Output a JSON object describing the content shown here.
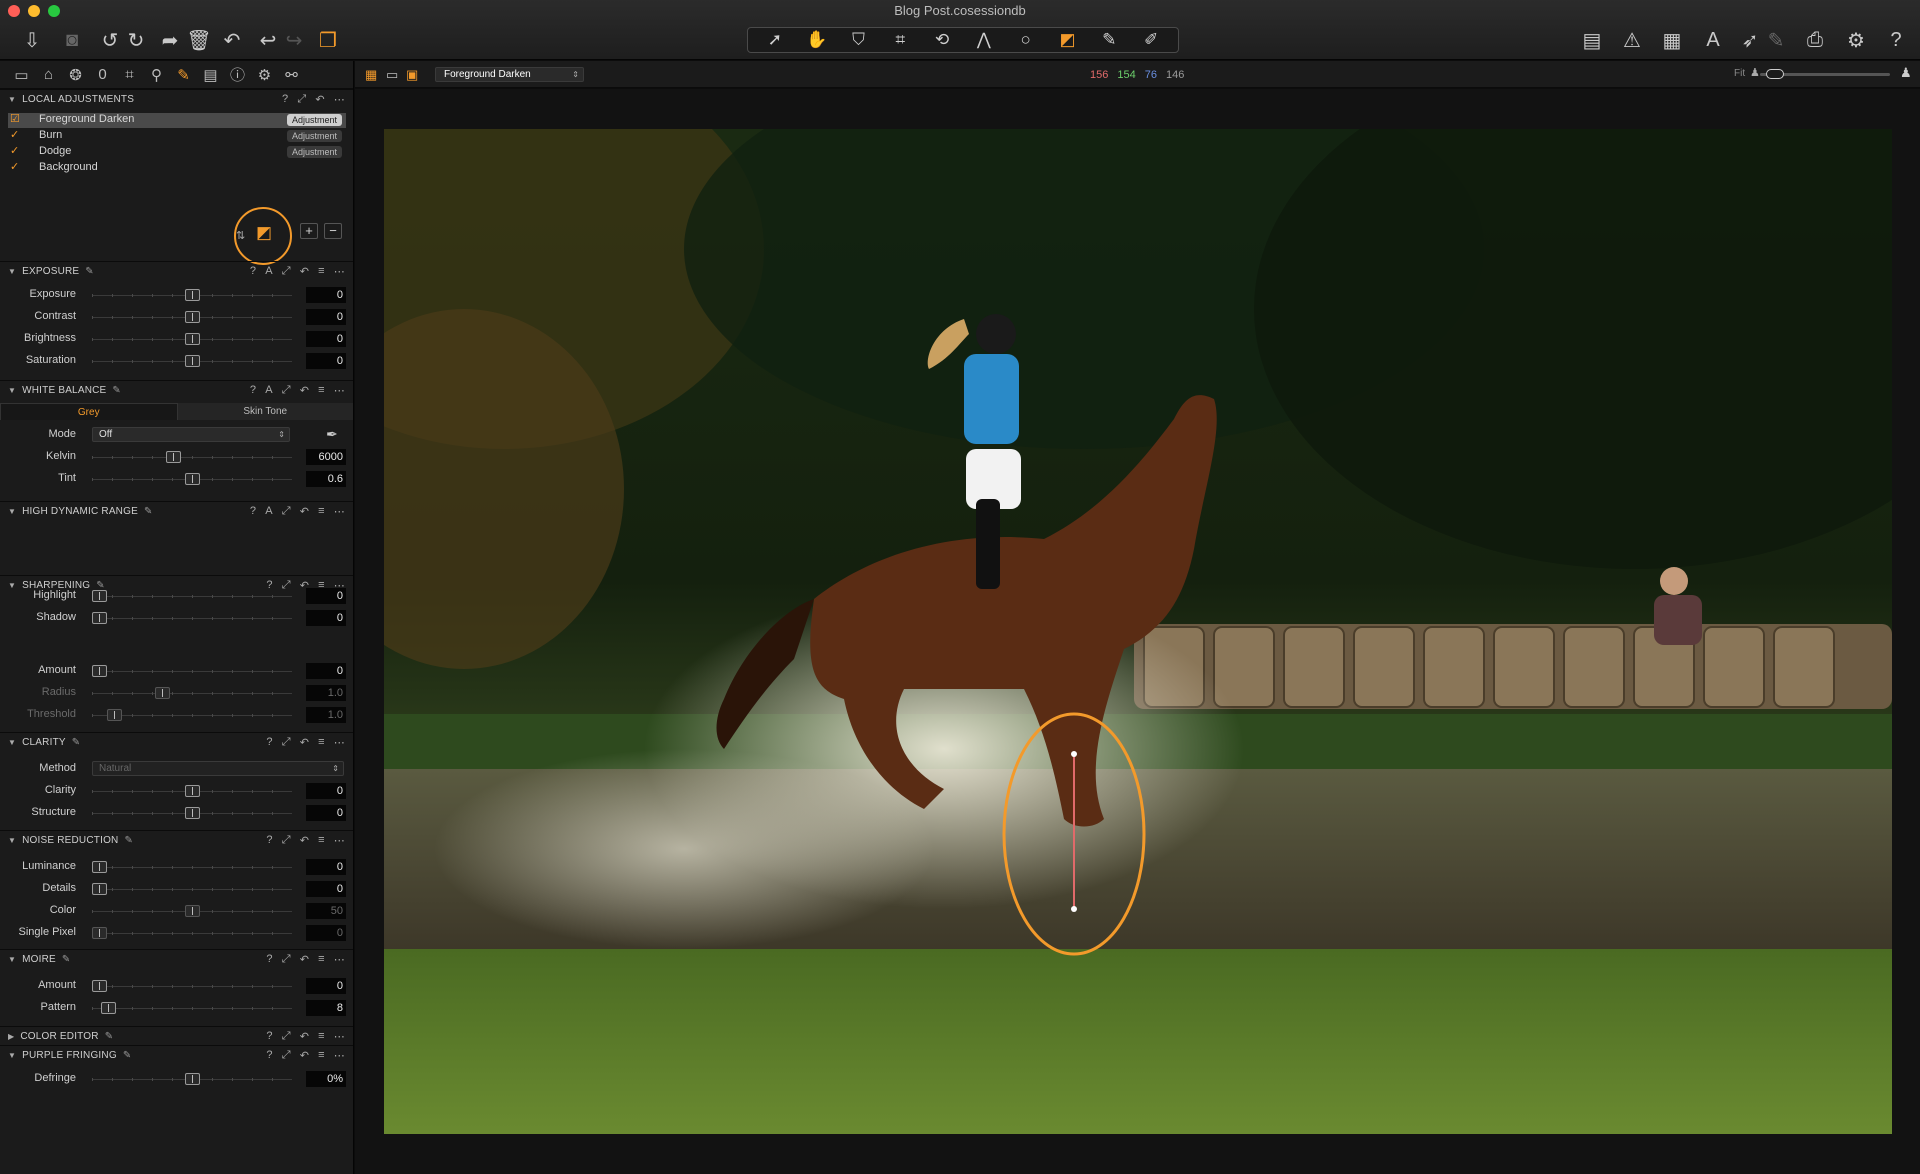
{
  "window": {
    "title": "Blog Post.cosessiondb",
    "traffic_colors": [
      "#ff5f57",
      "#febc2e",
      "#28c840"
    ]
  },
  "toolbar": {
    "left_icons": [
      "import-icon",
      "camera-icon",
      "rotate-left-icon",
      "rotate-right-icon",
      "export-icon",
      "trash-icon",
      "undo-icon",
      "redo-icon",
      "variants-icon"
    ],
    "cursor_tools": [
      "select-icon",
      "pan-icon",
      "loupe-icon",
      "crop-icon",
      "straighten-icon",
      "keystone-icon",
      "spot-icon",
      "draw-mask-icon",
      "erase-mask-icon",
      "copy-icon"
    ],
    "right_icons": [
      "layout-icon",
      "warning-icon",
      "grid-icon",
      "text-icon",
      "color-picker-icon",
      "apply-icon",
      "print-icon",
      "settings-icon",
      "help-icon"
    ]
  },
  "panel_tabs": [
    "folder-icon",
    "capture-icon",
    "color-icon",
    "lens-icon",
    "crop-tab-icon",
    "focus-icon",
    "brush-icon",
    "metadata-icon",
    "info-icon",
    "adjust-icon",
    "output-icon"
  ],
  "local_adjustments": {
    "title": "LOCAL ADJUSTMENTS",
    "layers": [
      {
        "name": "Foreground Darken",
        "badge": "Adjustment",
        "selected": true
      },
      {
        "name": "Burn",
        "badge": "Adjustment",
        "selected": false
      },
      {
        "name": "Dodge",
        "badge": "Adjustment",
        "selected": false
      },
      {
        "name": "Background",
        "badge": "",
        "selected": false
      }
    ]
  },
  "exposure": {
    "title": "EXPOSURE",
    "rows": [
      {
        "label": "Exposure",
        "value": "0",
        "level": 0.5
      },
      {
        "label": "Contrast",
        "value": "0",
        "level": 0.5
      },
      {
        "label": "Brightness",
        "value": "0",
        "level": 0.5
      },
      {
        "label": "Saturation",
        "value": "0",
        "level": 0.5
      }
    ]
  },
  "white_balance": {
    "title": "WHITE BALANCE",
    "tabs": [
      "Grey",
      "Skin Tone"
    ],
    "mode_label": "Mode",
    "mode_value": "Off",
    "rows": [
      {
        "label": "Kelvin",
        "value": "6000",
        "level": 0.4
      },
      {
        "label": "Tint",
        "value": "0.6",
        "level": 0.5
      }
    ]
  },
  "hdr": {
    "title": "HIGH DYNAMIC RANGE",
    "rows": [
      {
        "label": "Highlight",
        "value": "0",
        "level": 0.0
      },
      {
        "label": "Shadow",
        "value": "0",
        "level": 0.0
      }
    ]
  },
  "sharpening": {
    "title": "SHARPENING",
    "rows": [
      {
        "label": "Amount",
        "value": "0",
        "level": 0.0,
        "dim": false
      },
      {
        "label": "Radius",
        "value": "1.0",
        "level": 0.34,
        "dim": true
      },
      {
        "label": "Threshold",
        "value": "1.0",
        "level": 0.08,
        "dim": false
      }
    ]
  },
  "clarity": {
    "title": "CLARITY",
    "method_label": "Method",
    "method_value": "Natural",
    "rows": [
      {
        "label": "Clarity",
        "value": "0",
        "level": 0.5
      },
      {
        "label": "Structure",
        "value": "0",
        "level": 0.5
      }
    ]
  },
  "noise_reduction": {
    "title": "NOISE REDUCTION",
    "rows": [
      {
        "label": "Luminance",
        "value": "0",
        "level": 0.0,
        "dim": false
      },
      {
        "label": "Details",
        "value": "0",
        "level": 0.0,
        "dim": false
      },
      {
        "label": "Color",
        "value": "50",
        "level": 0.5,
        "dim": true
      },
      {
        "label": "Single Pixel",
        "value": "0",
        "level": 0.0,
        "dim": true
      }
    ]
  },
  "moire": {
    "title": "MOIRE",
    "rows": [
      {
        "label": "Amount",
        "value": "0",
        "level": 0.0
      },
      {
        "label": "Pattern",
        "value": "8",
        "level": 0.05
      }
    ]
  },
  "color_editor": {
    "title": "COLOR EDITOR"
  },
  "purple_fringing": {
    "title": "PURPLE FRINGING",
    "rows": [
      {
        "label": "Defringe",
        "value": "0%",
        "level": 0.5
      }
    ]
  },
  "viewer": {
    "layer_select": "Foreground Darken",
    "rgb": [
      {
        "value": "156",
        "color": "#e06a6a"
      },
      {
        "value": "154",
        "color": "#6ccf6c"
      },
      {
        "value": "76",
        "color": "#6a8fe0"
      },
      {
        "value": "146",
        "color": "#9a9a9a"
      }
    ],
    "fit_label": "Fit",
    "accent": "#f39a2b"
  }
}
